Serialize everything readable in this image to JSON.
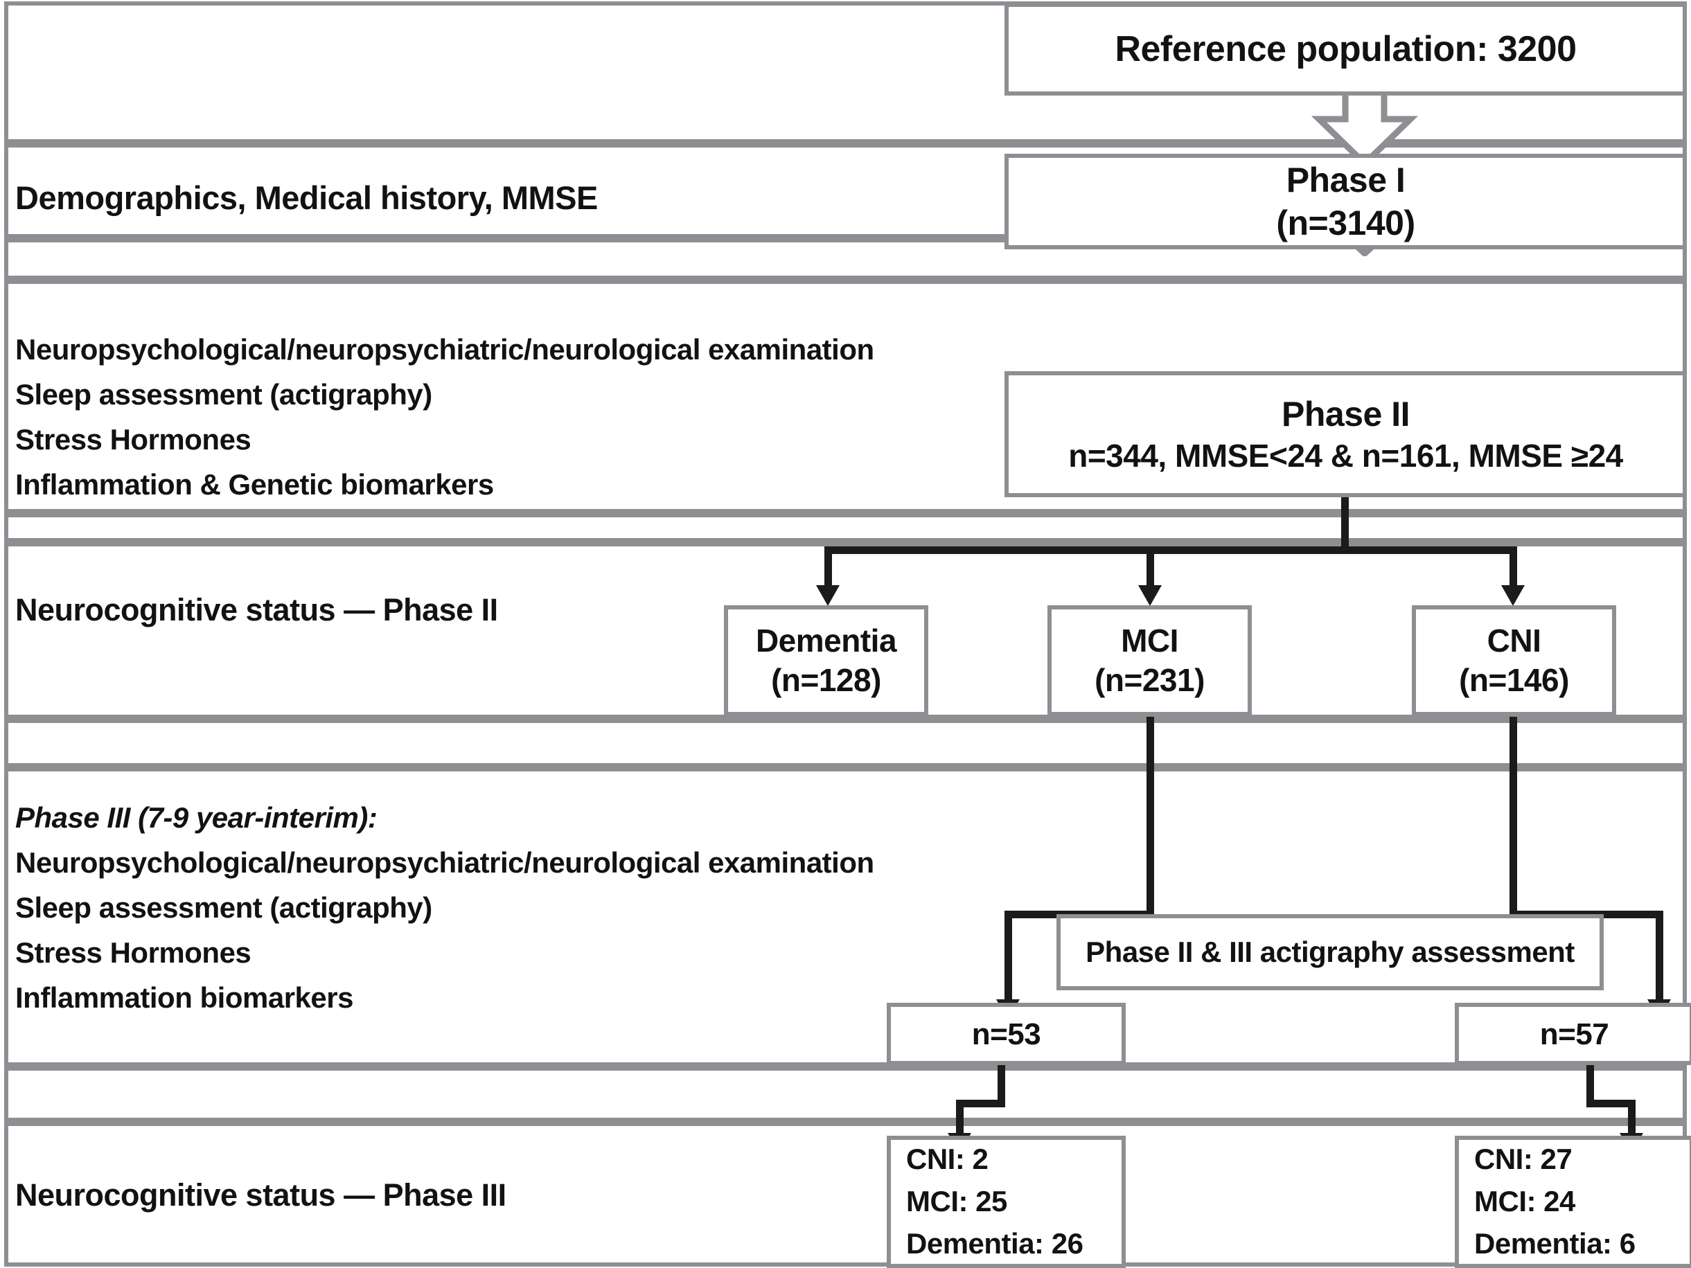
{
  "diagram": {
    "title": "Study flow: Reference population through Phase I, II and III",
    "accent_gray": "#8e8e93",
    "connector_black": "#1b1b1b",
    "background": "#ffffff"
  },
  "rows": [
    {
      "id": "row-reference",
      "label": ""
    },
    {
      "id": "row-phase1",
      "label": "Demographics,  Medical history, MMSE"
    },
    {
      "id": "row-gap1",
      "label": ""
    },
    {
      "id": "row-phase2",
      "label": ""
    },
    {
      "id": "row-gap2",
      "label": ""
    },
    {
      "id": "row-status2",
      "label": "Neurocognitive status — Phase II"
    },
    {
      "id": "row-gap3",
      "label": ""
    },
    {
      "id": "row-phase3",
      "label": ""
    },
    {
      "id": "row-gap4",
      "label": ""
    },
    {
      "id": "row-status3",
      "label": "Neurocognitive status — Phase III"
    }
  ],
  "side_labels": {
    "phase1": [
      "Demographics,  Medical history, MMSE"
    ],
    "phase2": [
      "Neuropsychological/neuropsychiatric/neurological  examination",
      "Sleep assessment  (actigraphy)",
      "Stress Hormones",
      "Inflammation  & Genetic biomarkers"
    ],
    "status2": "Neurocognitive status — Phase II",
    "phase3_heading": "Phase III (7-9 year-interim):",
    "phase3": [
      "Neuropsychological/neuropsychiatric/neurological  examination",
      "Sleep assessment  (actigraphy)",
      "Stress Hormones",
      "Inflammation  biomarkers"
    ],
    "status3": "Neurocognitive status — Phase III"
  },
  "boxes": {
    "reference": {
      "lines": [
        "Reference population: 3200"
      ]
    },
    "phase1": {
      "lines": [
        "Phase I",
        "(n=3140)"
      ]
    },
    "phase2": {
      "lines": [
        "Phase II",
        "n=344, MMSE<24 & n=161, MMSE ≥24"
      ]
    },
    "dementia": {
      "lines": [
        "Dementia",
        "(n=128)"
      ]
    },
    "mci": {
      "lines": [
        "MCI",
        "(n=231)"
      ]
    },
    "cni": {
      "lines": [
        "CNI",
        "(n=146)"
      ]
    },
    "actigraphy": {
      "lines": [
        "Phase II & III actigraphy assessment"
      ]
    },
    "n53": {
      "lines": [
        "n=53"
      ]
    },
    "n57": {
      "lines": [
        "n=57"
      ]
    },
    "outcome_left": {
      "lines": [
        "CNI: 2",
        "MCI: 25",
        "Dementia: 26"
      ]
    },
    "outcome_right": {
      "lines": [
        "CNI: 27",
        "MCI: 24",
        "Dementia: 6"
      ]
    }
  },
  "chart_data": {
    "type": "diagram",
    "title": "Study flow diagram",
    "nodes": [
      {
        "id": "reference",
        "label": "Reference population: 3200",
        "n": 3200
      },
      {
        "id": "phase1",
        "label": "Phase I (n=3140)",
        "n": 3140
      },
      {
        "id": "phase2",
        "label": "Phase II n=344, MMSE<24 & n=161, MMSE ≥24",
        "n_low_mmse": 344,
        "n_high_mmse": 161
      },
      {
        "id": "dementia",
        "label": "Dementia (n=128)",
        "n": 128
      },
      {
        "id": "mci",
        "label": "MCI (n=231)",
        "n": 231
      },
      {
        "id": "cni",
        "label": "CNI (n=146)",
        "n": 146
      },
      {
        "id": "actigraphy",
        "label": "Phase II & III actigraphy assessment"
      },
      {
        "id": "n53",
        "label": "n=53",
        "n": 53
      },
      {
        "id": "n57",
        "label": "n=57",
        "n": 57
      },
      {
        "id": "outcome_left",
        "label": "CNI: 2 / MCI: 25 / Dementia: 26",
        "CNI": 2,
        "MCI": 25,
        "Dementia": 26
      },
      {
        "id": "outcome_right",
        "label": "CNI: 27 / MCI: 24 / Dementia: 6",
        "CNI": 27,
        "MCI": 24,
        "Dementia": 6
      }
    ],
    "edges": [
      {
        "from": "reference",
        "to": "phase1",
        "style": "block-arrow"
      },
      {
        "from": "phase1",
        "to": "phase2",
        "style": "block-arrow"
      },
      {
        "from": "phase2",
        "to": "dementia",
        "style": "arrow"
      },
      {
        "from": "phase2",
        "to": "mci",
        "style": "arrow"
      },
      {
        "from": "phase2",
        "to": "cni",
        "style": "arrow"
      },
      {
        "from": "mci",
        "to": "n53",
        "style": "arrow"
      },
      {
        "from": "cni",
        "to": "n57",
        "style": "arrow"
      },
      {
        "from": "n53",
        "to": "outcome_left",
        "style": "arrow"
      },
      {
        "from": "n57",
        "to": "outcome_right",
        "style": "arrow"
      }
    ]
  }
}
